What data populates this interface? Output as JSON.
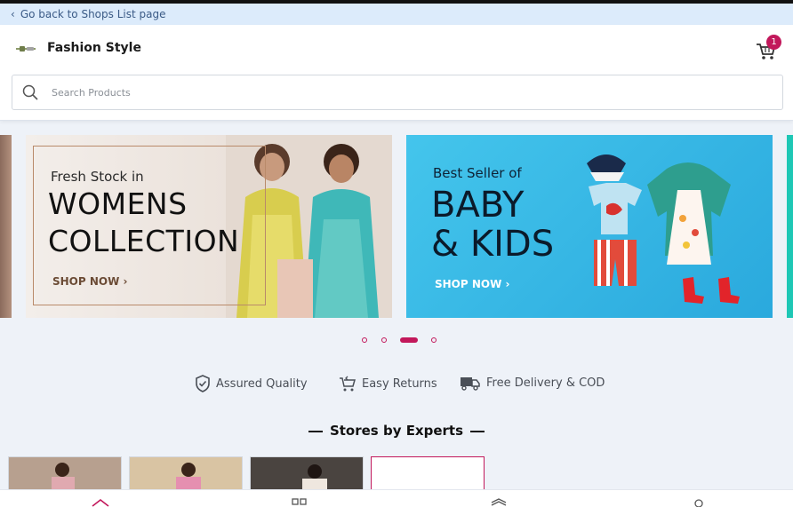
{
  "back_link": {
    "label": "Go back to Shops List page"
  },
  "header": {
    "shop_name": "Fashion Style",
    "cart_count": "1"
  },
  "search": {
    "placeholder": "Search Products"
  },
  "banners": [
    {
      "line1": "Fresh Stock in",
      "line2": "WOMENS",
      "line3": "COLLECTION",
      "cta": "SHOP NOW ›"
    },
    {
      "line1": "Best Seller of",
      "line2": "BABY",
      "line3": "& KIDS",
      "cta": "SHOP NOW ›"
    }
  ],
  "carousel": {
    "dot_count": 4,
    "active_index": 2
  },
  "features": [
    {
      "label": "Assured Quality",
      "icon": "shield-check-icon"
    },
    {
      "label": "Easy Returns",
      "icon": "cart-return-icon"
    },
    {
      "label": "Free Delivery & COD",
      "icon": "truck-icon"
    }
  ],
  "section": {
    "title": "Stores by Experts"
  },
  "colors": {
    "accent": "#c2185b",
    "back_bar": "#dcebfb",
    "kids_banner": "#2aa9dd"
  },
  "bottom_nav": [
    {
      "icon": "home-icon"
    },
    {
      "icon": "categories-icon"
    },
    {
      "icon": "box-icon"
    },
    {
      "icon": "account-icon"
    }
  ]
}
